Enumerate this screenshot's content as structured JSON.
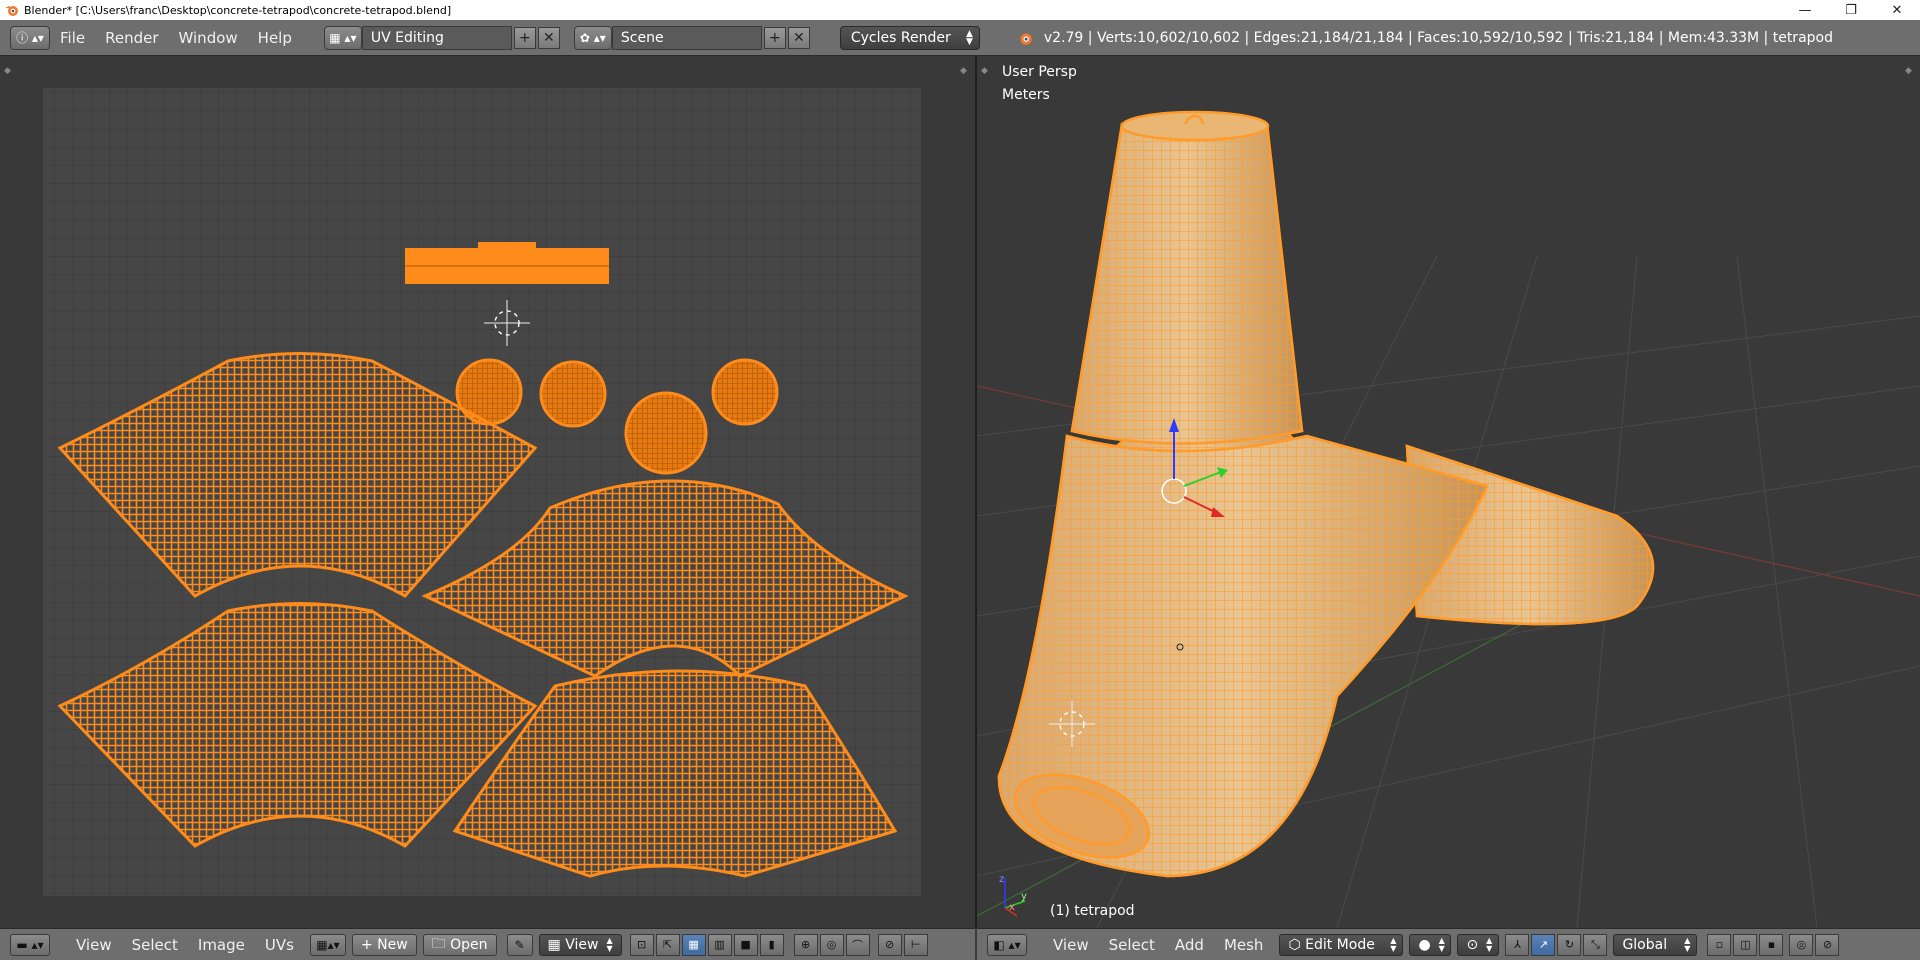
{
  "window": {
    "title": "Blender* [C:\\Users\\franc\\Desktop\\concrete-tetrapod\\concrete-tetrapod.blend]",
    "minimize": "—",
    "maximize": "❐",
    "close": "✕"
  },
  "info_header": {
    "editor_icon": "info-icon",
    "menus": [
      "File",
      "Render",
      "Window",
      "Help"
    ],
    "screen_layout": "UV Editing",
    "scene": "Scene",
    "render_engine": "Cycles Render",
    "stats": "v2.79 | Verts:10,602/10,602 | Edges:21,184/21,184 | Faces:10,592/10,592 | Tris:21,184 | Mem:43.33M | tetrapod"
  },
  "uv_editor": {
    "footer": {
      "menus": [
        "View",
        "Select",
        "Image",
        "UVs"
      ],
      "new_label": "New",
      "open_label": "Open",
      "view_label": "View"
    }
  },
  "viewport": {
    "view_name": "User Persp",
    "units": "Meters",
    "object_label": "(1) tetrapod",
    "footer": {
      "menus": [
        "View",
        "Select",
        "Add",
        "Mesh"
      ],
      "mode": "Edit Mode",
      "orientation": "Global"
    }
  },
  "colors": {
    "accent_orange": "#ff8c1a",
    "grid_bg": "#444444",
    "header_bg": "#6e6e6e",
    "active_blue": "#4a76ad"
  }
}
